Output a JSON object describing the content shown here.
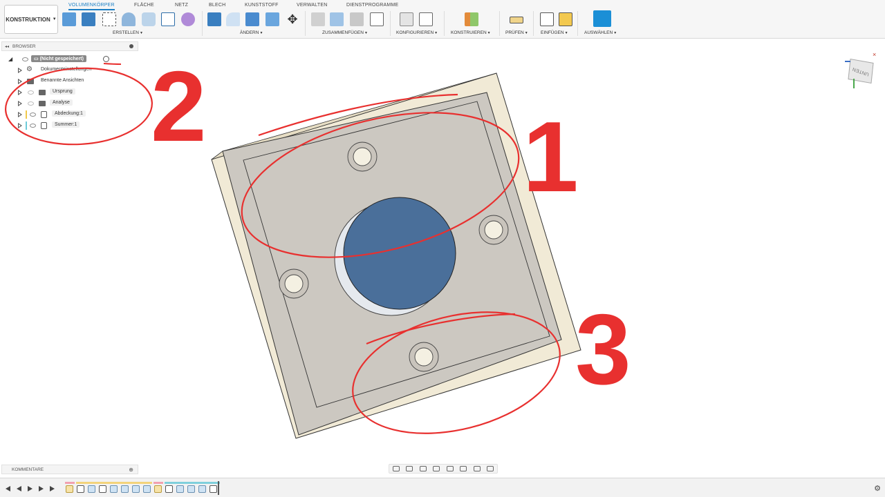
{
  "toolbar": {
    "workspace": "KONSTRUKTION",
    "tabs": [
      "VOLUMENKÖRPER",
      "FLÄCHE",
      "NETZ",
      "BLECH",
      "KUNSTSTOFF",
      "VERWALTEN",
      "DIENSTPROGRAMME"
    ],
    "active_tab": "VOLUMENKÖRPER",
    "groups": [
      "ERSTELLEN",
      "ÄNDERN",
      "ZUSAMMENFÜGEN",
      "KONFIGURIEREN",
      "KONSTRUIEREN",
      "PRÜFEN",
      "EINFÜGEN",
      "AUSWÄHLEN"
    ]
  },
  "browser": {
    "title": "BROWSER",
    "root": "(Nicht gespeichert)",
    "items": [
      {
        "label": "Dokumenteinstellungen",
        "icon": "gear-icon"
      },
      {
        "label": "Benannte Ansichten",
        "icon": "folder-icon"
      },
      {
        "label": "Ursprung",
        "icon": "folder-icon"
      },
      {
        "label": "Analyse",
        "icon": "folder-icon"
      },
      {
        "label": "Abdeckung:1",
        "icon": "component-icon"
      },
      {
        "label": "Summer:1",
        "icon": "component-icon"
      }
    ]
  },
  "comments": {
    "title": "KOMMENTARE"
  },
  "viewcube": {
    "face": "UNTEN"
  },
  "annotations": {
    "n1": "1",
    "n2": "2",
    "n3": "3"
  },
  "colors": {
    "accent": "#1a7fc5",
    "annotation": "#e8302f",
    "plate": "#cdc9c2",
    "frame": "#f1ead6",
    "disc": "#4a6f9a"
  }
}
